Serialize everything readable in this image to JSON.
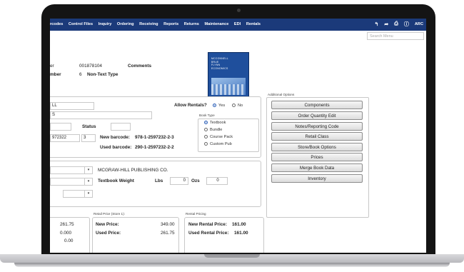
{
  "nav": {
    "items": [
      "rcodes",
      "Control Files",
      "Inquiry",
      "Ordering",
      "Receiving",
      "Reports",
      "Returns",
      "Maintenance",
      "EDI",
      "Rentals"
    ],
    "user": "ARC"
  },
  "search": {
    "placeholder": "Search Menu"
  },
  "item": {
    "number_label": "er",
    "number_value": "001878104",
    "comments_label": "Comments",
    "edition_label": "mber",
    "edition_value": "6",
    "type_value": "Non-Text Type"
  },
  "form": {
    "field1": "LL",
    "field2": "S",
    "status_label": "Status",
    "isbn_partial": "972322",
    "copies": "3",
    "new_barcode_label": "New barcode:",
    "new_barcode_value": "978-1-2597232-2-3",
    "used_barcode_label": "Used barcode:",
    "used_barcode_value": "290-1-2597232-2-2",
    "allow_rentals_label": "Allow Rentals?",
    "rental_yes": "Yes",
    "rental_no": "No",
    "rental_selected": "Yes",
    "book_type_title": "Book Type",
    "book_types": [
      "Textbook",
      "Bundle",
      "Course Pack",
      "Custom Pub"
    ],
    "book_type_selected": "Textbook"
  },
  "publisher": {
    "name": "MCGRAW-HILL PUBLISHING CO.",
    "weight_label": "Textbook Weight",
    "lbs_label": "Lbs",
    "lbs_value": "0",
    "ozs_label": "Ozs",
    "ozs_value": "0"
  },
  "additional": {
    "title": "Additional Options",
    "buttons": [
      "Components",
      "Order Quantity Edit",
      "Notes/Reporting Code",
      "Retail Class",
      "Store/Book Options",
      "Prices",
      "Merge Book Data",
      "Inventory"
    ]
  },
  "cover": {
    "text_lines": [
      "MCCONNELL",
      "BRUE",
      "FLYNN",
      "ECONOMICS"
    ]
  },
  "prices": {
    "left_values": [
      "261.75",
      "0.000",
      "0.00"
    ],
    "retail_title": "Retail Price (Store 1):",
    "new_price_label": "New Price:",
    "new_price_value": "349.00",
    "used_price_label": "Used Price:",
    "used_price_value": "261.75",
    "rental_title": "Rental Pricing",
    "new_rental_label": "New Rental Price:",
    "new_rental_value": "161.00",
    "used_rental_label": "Used Rental Price:",
    "used_rental_value": "161.00"
  }
}
